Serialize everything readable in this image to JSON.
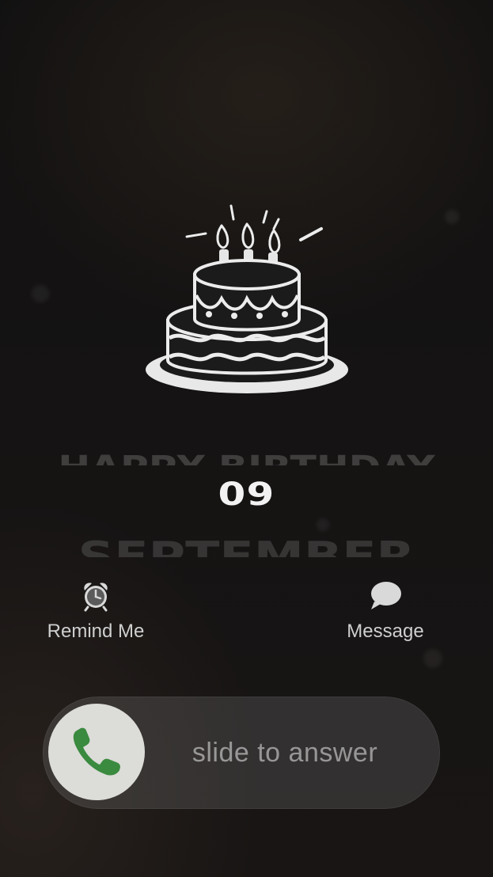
{
  "heading": {
    "happy_birthday": "HAPPY BIRTHDAY",
    "date": "09",
    "month": "SEPTEMBER"
  },
  "actions": {
    "remind_label": "Remind Me",
    "message_label": "Message"
  },
  "slider": {
    "label": "slide to answer",
    "knob_icon": "phone-icon",
    "knob_icon_color": "#3a8a3f"
  },
  "icons": {
    "cake": "birthday-cake-icon",
    "remind": "alarm-clock-icon",
    "message": "speech-bubble-icon"
  }
}
